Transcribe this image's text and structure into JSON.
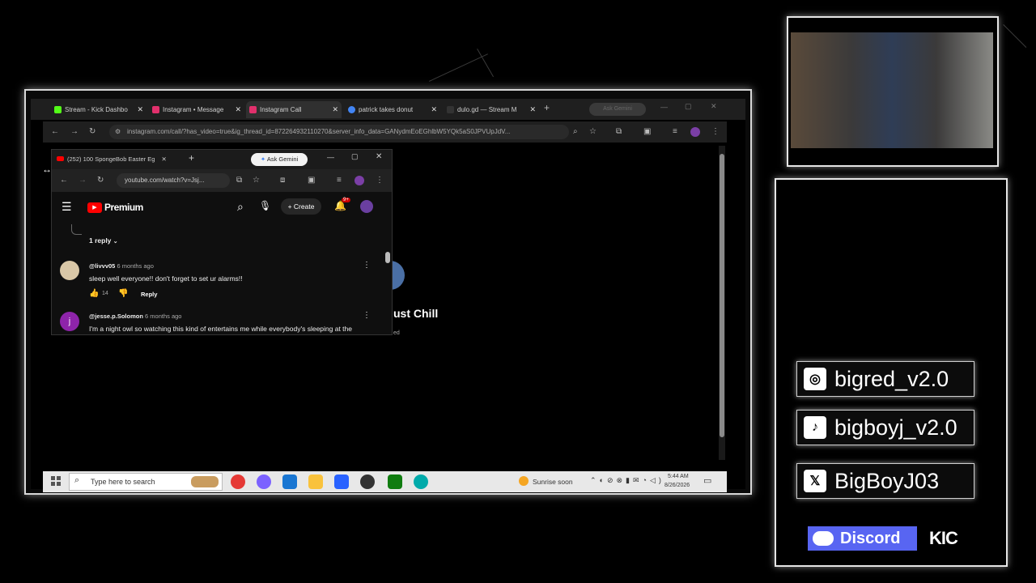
{
  "outer_browser": {
    "tabs": [
      {
        "title": "Stream - Kick Dashbo",
        "color": "#53fc18"
      },
      {
        "title": "Instagram • Message",
        "color": "#e1306c"
      },
      {
        "title": "Instagram Call",
        "color": "#e1306c",
        "active": true
      },
      {
        "title": "patrick takes donut",
        "color": "#4285f4"
      },
      {
        "title": "dulo.gd — Stream M",
        "color": "#333333"
      }
    ],
    "ask_gemini": "Ask Gemini",
    "url": "instagram.com/call/?has_video=true&ig_thread_id=872264932110270&server_info_data=GANydmEoEGhlbW5YQk5aS0JPVUpJdV...",
    "call_partial_text": "ust Chill",
    "call_partial_sub": "ed"
  },
  "yt_window": {
    "tab_title": "(252) 100 SpongeBob Easter Eg",
    "ask_gemini": "Ask Gemini",
    "url": "youtube.com/watch?v=Jsj...",
    "logo_text": "Premium",
    "create_label": "Create",
    "notif_count": "9+",
    "replies_label": "1 reply",
    "comments": [
      {
        "author": "@livvv05",
        "time": "6 months ago",
        "text": "sleep well everyone!! don't forget to set ur alarms!!",
        "likes": "14",
        "reply_label": "Reply",
        "avatar_color": "#d9c7a7"
      },
      {
        "author": "@jesse.p.Solomon",
        "time": "6 months ago",
        "text": "I'm a night owl so watching this kind of entertains me while everybody's sleeping at the",
        "avatar_color": "#8e24aa",
        "avatar_letter": "j"
      }
    ]
  },
  "taskbar": {
    "search_placeholder": "Type here to search",
    "weather": "Sunrise soon",
    "time": "5:44 AM",
    "date": "8/26/2026"
  },
  "socials": [
    {
      "platform": "instagram",
      "handle": "bigred_v2.0"
    },
    {
      "platform": "tiktok",
      "handle": "bigboyj_v2.0"
    },
    {
      "platform": "x",
      "handle": "BigBoyJ03"
    }
  ],
  "discord_label": "Discord",
  "kick_label": "KIC",
  "colors": {
    "frame": "#e6e6e6",
    "youtube_red": "#ff0000",
    "discord": "#5865f2"
  }
}
